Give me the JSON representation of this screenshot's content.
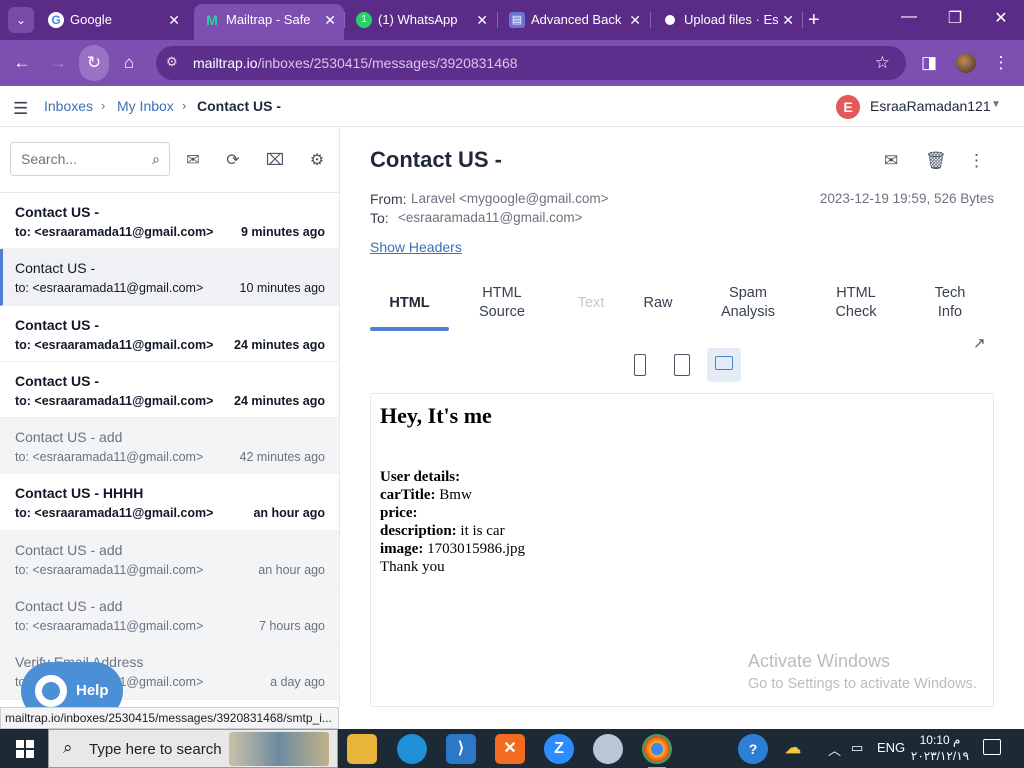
{
  "browser": {
    "tabs": [
      {
        "title": "Google",
        "favicon_color": "#ffffff",
        "favicon_glyph": "G"
      },
      {
        "title": "Mailtrap - Safe",
        "favicon_color": "#2bd39b",
        "favicon_glyph": "M"
      },
      {
        "title": "(1) WhatsApp",
        "favicon_color": "#25d366",
        "favicon_glyph": "1"
      },
      {
        "title": "Advanced Back",
        "favicon_color": "#6b74d6",
        "favicon_glyph": "▤"
      },
      {
        "title": "Upload files · Es",
        "favicon_color": "#ffffff",
        "favicon_glyph": "●"
      }
    ],
    "active_tab": 1,
    "url_host": "mailtrap.io",
    "url_path": "/inboxes/2530415/messages/3920831468",
    "status_url": "mailtrap.io/inboxes/2530415/messages/3920831468/smtp_i..."
  },
  "header": {
    "breadcrumb": [
      "Inboxes",
      "My Inbox",
      "Contact US -"
    ],
    "user_initial": "E",
    "user_name": "EsraaRamadan121"
  },
  "search": {
    "placeholder": "Search..."
  },
  "messages": [
    {
      "subject": "Contact US -",
      "to": "to: <esraaramada11@gmail.com>",
      "time": "9 minutes ago",
      "state": "unread"
    },
    {
      "subject": "Contact US -",
      "to": "to: <esraaramada11@gmail.com>",
      "time": "10 minutes ago",
      "state": "selected"
    },
    {
      "subject": "Contact US -",
      "to": "to: <esraaramada11@gmail.com>",
      "time": "24 minutes ago",
      "state": "unread"
    },
    {
      "subject": "Contact US -",
      "to": "to: <esraaramada11@gmail.com>",
      "time": "24 minutes ago",
      "state": "unread"
    },
    {
      "subject": "Contact US - add",
      "to": "to: <esraaramada11@gmail.com>",
      "time": "42 minutes ago",
      "state": "read"
    },
    {
      "subject": "Contact US - HHHH",
      "to": "to: <esraaramada11@gmail.com>",
      "time": "an hour ago",
      "state": "unread"
    },
    {
      "subject": "Contact US - add",
      "to": "to: <esraaramada11@gmail.com>",
      "time": "an hour ago",
      "state": "read"
    },
    {
      "subject": "Contact US - add",
      "to": "to: <esraaramada11@gmail.com>",
      "time": "7 hours ago",
      "state": "read"
    },
    {
      "subject": "Verify Email Address",
      "to": "to: <esraaramada11@gmail.com>",
      "time": "a day ago",
      "state": "read"
    }
  ],
  "help_label": "Help",
  "detail": {
    "title": "Contact US -",
    "from_label": "From:",
    "from_value": "Laravel <mygoogle@gmail.com>",
    "to_label": "To:",
    "to_value": "<esraaramada11@gmail.com>",
    "date_size": "2023-12-19 19:59, 526 Bytes",
    "show_headers": "Show Headers",
    "tabs": [
      {
        "label": "HTML",
        "state": "active"
      },
      {
        "label": "HTML\nSource",
        "state": "normal"
      },
      {
        "label": "Text",
        "state": "disabled"
      },
      {
        "label": "Raw",
        "state": "normal"
      },
      {
        "label": "Spam\nAnalysis",
        "state": "normal"
      },
      {
        "label": "HTML\nCheck",
        "state": "normal"
      },
      {
        "label": "Tech\nInfo",
        "state": "normal"
      }
    ],
    "device_active": "desktop"
  },
  "preview": {
    "heading": "Hey, It's me",
    "rows": [
      {
        "label": "User details:",
        "value": ""
      },
      {
        "label": "carTitle:",
        "value": " Bmw"
      },
      {
        "label": "price:",
        "value": ""
      },
      {
        "label": "description:",
        "value": " it is car"
      },
      {
        "label": "image:",
        "value": " 1703015986.jpg"
      }
    ],
    "closing": "Thank you"
  },
  "watermark": {
    "line1": "Activate Windows",
    "line2": "Go to Settings to activate Windows."
  },
  "taskbar": {
    "search_placeholder": "Type here to search",
    "lang": "ENG",
    "time": "10:10 م",
    "date": "٢٠٢٣/١٢/١٩"
  }
}
